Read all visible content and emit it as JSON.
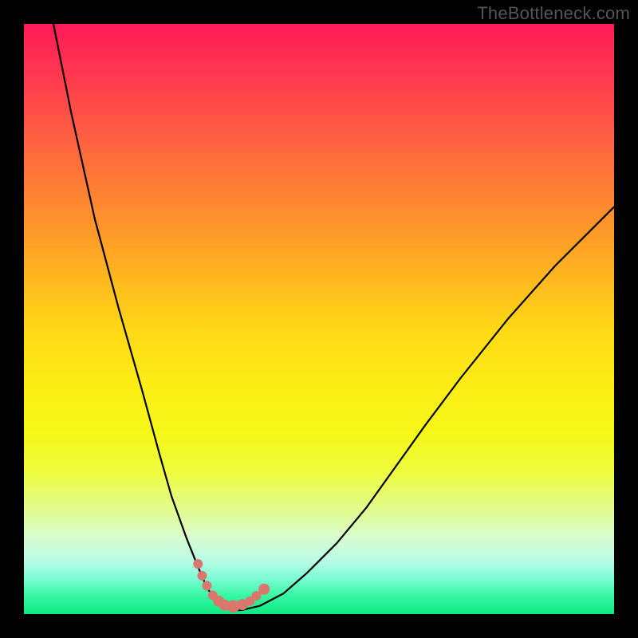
{
  "watermark": "TheBottleneck.com",
  "chart_data": {
    "type": "line",
    "title": "",
    "xlabel": "",
    "ylabel": "",
    "xlim": [
      0,
      100
    ],
    "ylim": [
      0,
      100
    ],
    "series": [
      {
        "name": "curve",
        "x": [
          5,
          8,
          12,
          16,
          20,
          23,
          25,
          27.5,
          29.5,
          31,
          32.5,
          34,
          35.5,
          37,
          40,
          44,
          48,
          53,
          58,
          63,
          68,
          74,
          82,
          90,
          100
        ],
        "y": [
          100,
          85,
          67,
          52,
          38,
          27,
          20,
          13,
          8,
          4.5,
          2.3,
          1.2,
          0.6,
          0.7,
          1.4,
          3.5,
          7,
          12,
          18,
          25,
          32,
          40,
          50,
          59,
          69
        ]
      }
    ],
    "markers": {
      "name": "dots",
      "x": [
        29.5,
        30.2,
        31,
        32,
        33,
        34,
        35.5,
        37,
        38.3,
        39.4,
        40.7
      ],
      "y": [
        8.5,
        6.5,
        4.8,
        3.2,
        2.2,
        1.5,
        1.3,
        1.6,
        2.2,
        3.1,
        4.2
      ],
      "r": [
        6,
        6,
        6,
        6,
        7,
        7,
        8,
        7,
        6,
        6,
        7
      ]
    },
    "colors": {
      "curve_stroke": "#000000",
      "marker_fill": "#d9776e"
    }
  }
}
